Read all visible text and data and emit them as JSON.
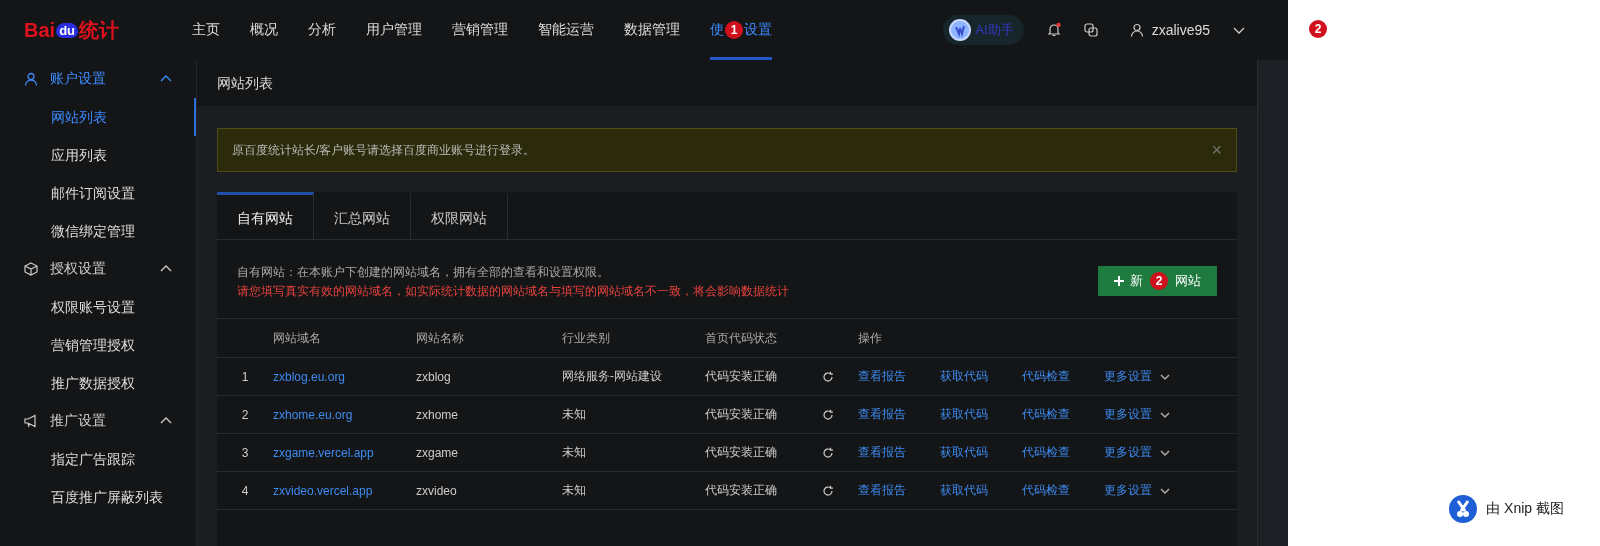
{
  "logo": {
    "brand": "Bai",
    "paw": "du",
    "product": "统计"
  },
  "nav": [
    {
      "label": "主页",
      "selected": false
    },
    {
      "label": "概况",
      "selected": false
    },
    {
      "label": "分析",
      "selected": false
    },
    {
      "label": "用户管理",
      "selected": false
    },
    {
      "label": "营销管理",
      "selected": false
    },
    {
      "label": "智能运营",
      "selected": false
    },
    {
      "label": "数据管理",
      "selected": false
    },
    {
      "label": "使",
      "marker": "1",
      "label_rest": "设置",
      "selected": true
    }
  ],
  "header": {
    "assistant": "AI助手",
    "notification_dot": true,
    "user": "zxalive95"
  },
  "sidebar": [
    {
      "label": "账户设置",
      "expanded": true,
      "selected": true,
      "children": [
        {
          "label": "网站列表",
          "selected": true
        },
        {
          "label": "应用列表",
          "selected": false
        },
        {
          "label": "邮件订阅设置",
          "selected": false
        },
        {
          "label": "微信绑定管理",
          "selected": false
        }
      ]
    },
    {
      "label": "授权设置",
      "expanded": true,
      "selected": false,
      "children": [
        {
          "label": "权限账号设置",
          "selected": false
        },
        {
          "label": "营销管理授权",
          "selected": false
        },
        {
          "label": "推广数据授权",
          "selected": false
        }
      ]
    },
    {
      "label": "推广设置",
      "expanded": true,
      "selected": false,
      "children": [
        {
          "label": "指定广告跟踪",
          "selected": false
        },
        {
          "label": "百度推广屏蔽列表",
          "selected": false
        }
      ]
    }
  ],
  "page_title": "网站列表",
  "alert": {
    "text": "原百度统计站长/客户账号请选择百度商业账号进行登录。",
    "close": "×"
  },
  "tabs": [
    {
      "label": "自有网站",
      "selected": true
    },
    {
      "label": "汇总网站",
      "selected": false
    },
    {
      "label": "权限网站",
      "selected": false
    }
  ],
  "description": "自有网站：在本账户下创建的网站域名，拥有全部的查看和设置权限。",
  "warning": "请您填写真实有效的网站域名，如实际统计数据的网站域名与填写的网站域名不一致，将会影响数据统计",
  "add_button": {
    "label": "新",
    "marker": "2",
    "label_rest": "网站"
  },
  "table": {
    "columns": [
      "网站域名",
      "网站名称",
      "行业类别",
      "首页代码状态",
      "操作"
    ],
    "rows": [
      {
        "index": "1",
        "domain": "zxblog.eu.org",
        "name": "zxblog",
        "industry": "网络服务-网站建设",
        "status": "代码安装正确",
        "actions": [
          "查看报告",
          "获取代码",
          "代码检查",
          "更多设置"
        ]
      },
      {
        "index": "2",
        "domain": "zxhome.eu.org",
        "name": "zxhome",
        "industry": "未知",
        "status": "代码安装正确",
        "actions": [
          "查看报告",
          "获取代码",
          "代码检查",
          "更多设置"
        ]
      },
      {
        "index": "3",
        "domain": "zxgame.vercel.app",
        "name": "zxgame",
        "industry": "未知",
        "status": "代码安装正确",
        "actions": [
          "查看报告",
          "获取代码",
          "代码检查",
          "更多设置"
        ]
      },
      {
        "index": "4",
        "domain": "zxvideo.vercel.app",
        "name": "zxvideo",
        "industry": "未知",
        "status": "代码安装正确",
        "actions": [
          "查看报告",
          "获取代码",
          "代码检查",
          "更多设置"
        ]
      }
    ]
  },
  "canvas_marker": "2",
  "capture_badge": {
    "text": "由 Xnip 截图"
  }
}
